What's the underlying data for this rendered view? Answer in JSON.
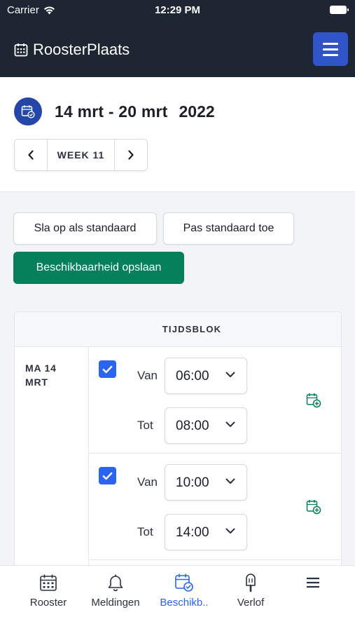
{
  "status_bar": {
    "carrier": "Carrier",
    "time": "12:29 PM"
  },
  "brand": {
    "name": "RoosterPlaats"
  },
  "week": {
    "range": "14 mrt - 20 mrt",
    "year": "2022",
    "label": "WEEK 11"
  },
  "actions": {
    "save_default": "Sla op als standaard",
    "apply_default": "Pas standaard toe",
    "save_availability": "Beschikbaarheid opslaan"
  },
  "table": {
    "header": "TIJDSBLOK",
    "day_label": "MA 14 MRT",
    "slots": [
      {
        "checked": true,
        "from_label": "Van",
        "from": "06:00",
        "to_label": "Tot",
        "to": "08:00"
      },
      {
        "checked": true,
        "from_label": "Van",
        "from": "10:00",
        "to_label": "Tot",
        "to": "14:00"
      }
    ]
  },
  "tabs": [
    {
      "label": "Rooster",
      "icon": "calendar-icon",
      "active": false
    },
    {
      "label": "Meldingen",
      "icon": "bell-icon",
      "active": false
    },
    {
      "label": "Beschikb..",
      "icon": "calendar-check-icon",
      "active": true
    },
    {
      "label": "Verlof",
      "icon": "popsicle-icon",
      "active": false
    },
    {
      "label": "",
      "icon": "hamburger-menu-icon",
      "active": false
    }
  ],
  "colors": {
    "navbar": "#1e2633",
    "primary": "#2a64f0",
    "success": "#06805a",
    "accent_dark": "#2446a8"
  }
}
